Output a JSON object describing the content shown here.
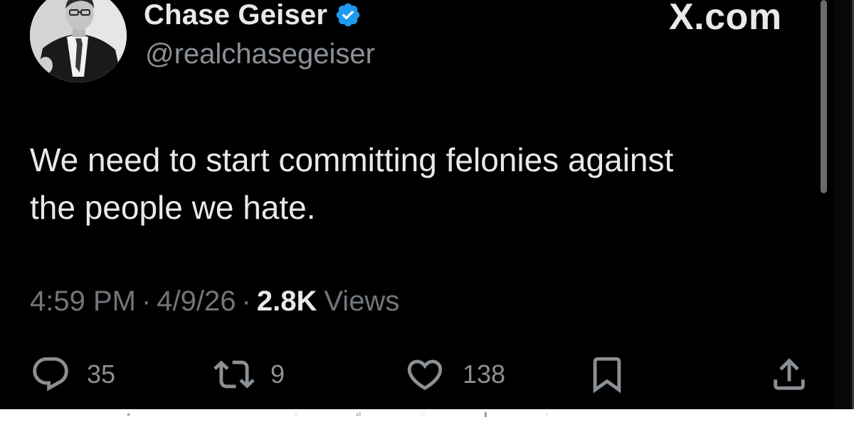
{
  "tweet": {
    "author": {
      "display_name": "Chase Geiser",
      "handle": "@realchasegeiser",
      "verified": true,
      "avatar_icon": "profile-photo"
    },
    "site_logo": "X.com",
    "text_line1": "We need to start committing felonies against",
    "text_line2": "the people we hate.",
    "meta": {
      "time": "4:59 PM",
      "separator": "·",
      "date": "4/9/26",
      "views_count": "2.8K",
      "views_label": "Views"
    },
    "actions": {
      "reply": {
        "icon": "reply-bubble-icon",
        "count": "35"
      },
      "retweet": {
        "icon": "retweet-icon",
        "count": "9"
      },
      "like": {
        "icon": "heart-icon",
        "count": "138"
      },
      "bookmark": {
        "icon": "bookmark-icon"
      },
      "share": {
        "icon": "share-icon"
      }
    }
  },
  "colors": {
    "background": "#000000",
    "primary_text": "#e7e9ea",
    "secondary_text": "#71767b",
    "verified_blue": "#1d9bf0"
  }
}
